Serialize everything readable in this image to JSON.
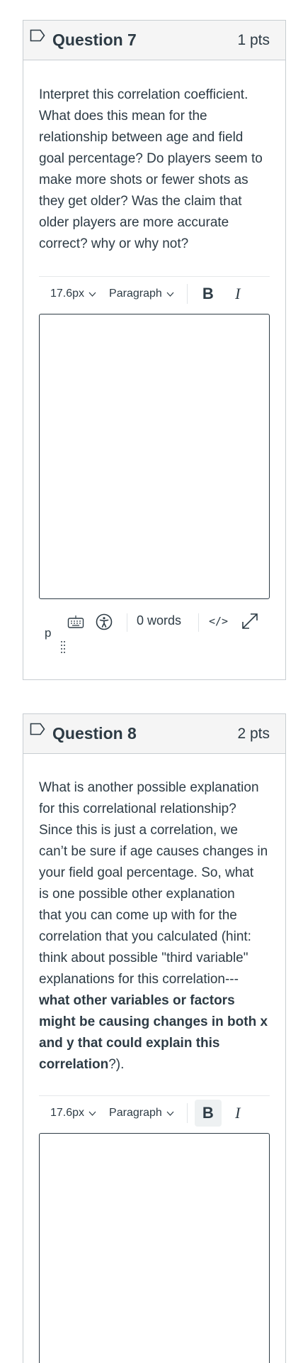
{
  "questions": [
    {
      "title": "Question 7",
      "points": "1 pts",
      "text_lines": [
        "Interpret this correlation coefficient.",
        "What does this mean for the",
        "relationship between age and field",
        "goal percentage? Do players seem to",
        "make more shots or fewer shots as",
        "they get older? Was the claim that",
        "older players are more accurate",
        "correct? why or why not?"
      ],
      "toolbar": {
        "font_size": "17.6px",
        "block_format": "Paragraph",
        "bold": "B",
        "italic": "I"
      },
      "status": {
        "path": "p",
        "word_count": "0 words",
        "html_toggle": "</>"
      }
    },
    {
      "title": "Question 8",
      "points": "2 pts",
      "text_lines": [
        "What is another possible explanation",
        "for this correlational relationship?",
        "Since this is just a correlation, we",
        "can’t be sure if age causes changes in",
        "your field goal percentage. So, what",
        "is one possible other explanation",
        "that you can come up with for the",
        "correlation that you calculated (hint:",
        "think about possible \"third variable\"",
        "explanations for this correlation---"
      ],
      "bold_lines": [
        "what other variables or factors",
        "might be causing changes in both x",
        "and y that could explain this"
      ],
      "last_line_bold": "correlation",
      "last_line_tail": "?).",
      "toolbar": {
        "font_size": "17.6px",
        "block_format": "Paragraph",
        "bold": "B",
        "italic": "I"
      }
    }
  ],
  "colors": {
    "text": "#2d3b45",
    "header_bg": "#f5f5f5",
    "border": "#c7cdd1"
  },
  "icons": [
    "flag-icon",
    "chevron-down-icon",
    "keyboard-icon",
    "accessibility-icon",
    "fullscreen-icon",
    "resize-handle-icon"
  ]
}
